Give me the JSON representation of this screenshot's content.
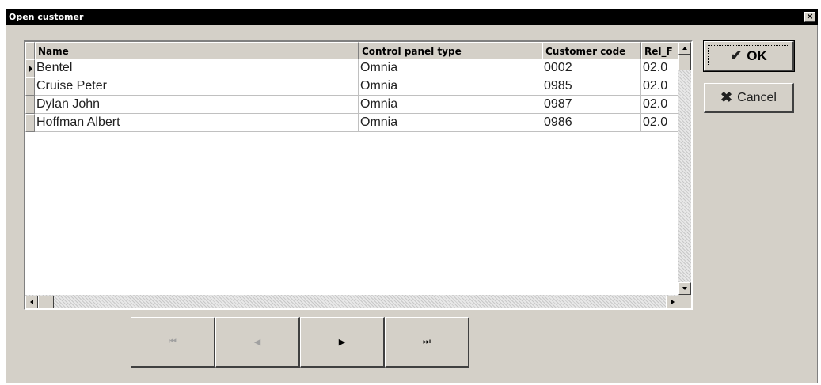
{
  "window": {
    "title": "Open customer",
    "close_glyph": "×"
  },
  "grid": {
    "columns": [
      "Name",
      "Control panel type",
      "Customer code",
      "Rel_F"
    ],
    "rows": [
      {
        "name": "Bentel",
        "panel_type": "Omnia",
        "code": "0002",
        "rel": "02.0",
        "current": true
      },
      {
        "name": "Cruise Peter",
        "panel_type": "Omnia",
        "code": "0985",
        "rel": "02.0",
        "current": false
      },
      {
        "name": "Dylan John",
        "panel_type": "Omnia",
        "code": "0987",
        "rel": "02.0",
        "current": false
      },
      {
        "name": "Hoffman Albert",
        "panel_type": "Omnia",
        "code": "0986",
        "rel": "02.0",
        "current": false
      }
    ]
  },
  "buttons": {
    "ok_label": "OK",
    "ok_icon": "✔",
    "cancel_label": "Cancel",
    "cancel_icon": "✖"
  },
  "navigator": {
    "first_icon": "⏮",
    "prior_icon": "◀",
    "next_icon": "▶",
    "last_icon": "⏭"
  },
  "colors": {
    "face": "#d4d0c8",
    "titlebar": "#000000"
  }
}
